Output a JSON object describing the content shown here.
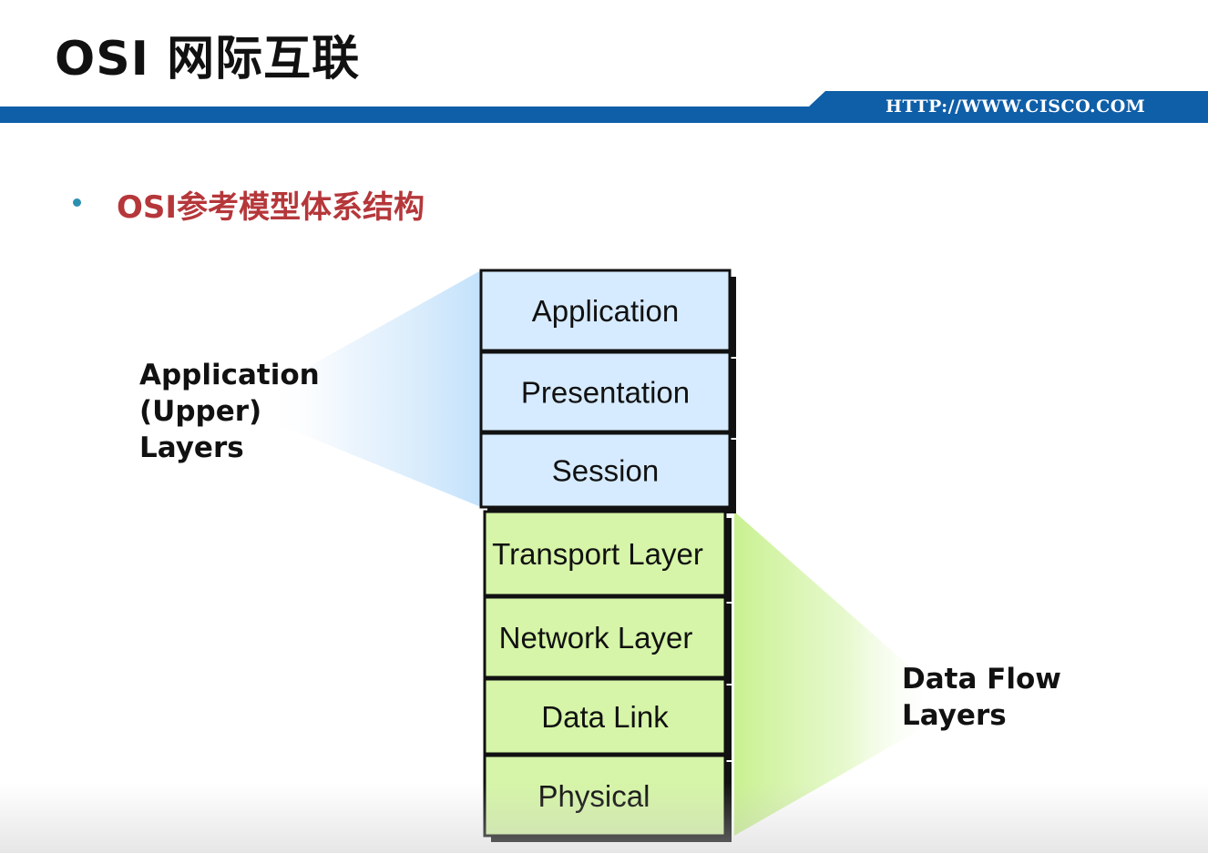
{
  "header": {
    "title": "OSI 网际互联",
    "url": "HTTP://WWW.CISCO.COM",
    "bar_color": "#0f5ea8"
  },
  "bullet": {
    "text": "OSI参考模型体系结构",
    "text_color": "#b5373a",
    "dot_color": "#2c8fb0"
  },
  "diagram": {
    "upper_layers": [
      "Application",
      "Presentation",
      "Session"
    ],
    "lower_layers": [
      "Transport Layer",
      "Network Layer",
      "Data Link",
      "Physical"
    ],
    "upper_fill": "#d6ebff",
    "lower_fill": "#d6f5a8",
    "upper_group_label": [
      "Application",
      "(Upper)",
      "Layers"
    ],
    "lower_group_label": [
      "Data Flow",
      "Layers"
    ]
  }
}
